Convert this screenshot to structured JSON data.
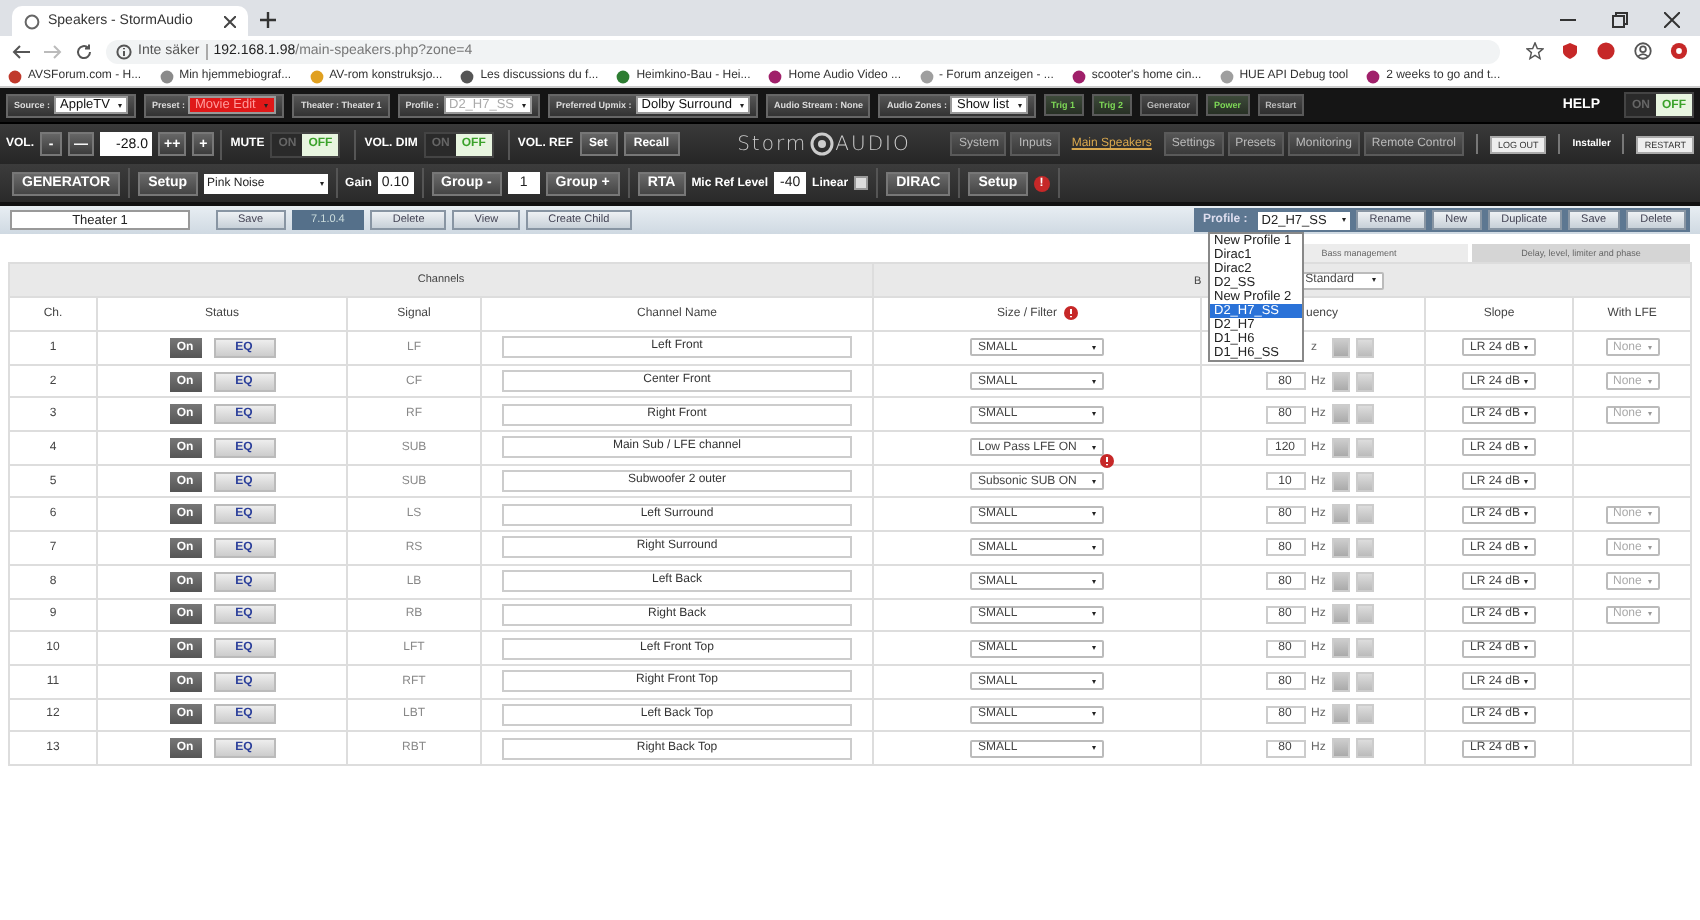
{
  "browser": {
    "tab_title": "Speakers - StormAudio",
    "security": "Inte säker",
    "url_host": "192.168.1.98",
    "url_path": "/main-speakers.php?zone=4",
    "bookmarks": [
      {
        "label": "AVSForum.com - H...",
        "color": "#c0392b"
      },
      {
        "label": "Min hjemmebiograf...",
        "color": "#8a8a8a"
      },
      {
        "label": "AV-rom konstruksjo...",
        "color": "#e0a020"
      },
      {
        "label": "Les discussions du f...",
        "color": "#555555"
      },
      {
        "label": "Heimkino-Bau - Hei...",
        "color": "#2e7d32"
      },
      {
        "label": "Home Audio Video ...",
        "color": "#a0206a"
      },
      {
        "label": "- Forum anzeigen - ...",
        "color": "#9e9e9e"
      },
      {
        "label": "scooter's home cin...",
        "color": "#a0206a"
      },
      {
        "label": "HUE API Debug tool",
        "color": "#9e9e9e"
      },
      {
        "label": "2 weeks to go and t...",
        "color": "#a0206a"
      }
    ]
  },
  "topbar": {
    "fields": [
      {
        "kind": "select",
        "label": "Source :",
        "value": "AppleTV"
      },
      {
        "kind": "alert",
        "label": "Preset :",
        "value": "Movie Edit"
      },
      {
        "kind": "label",
        "label": "Theater : Theater 1"
      },
      {
        "kind": "disabled",
        "label": "Profile :",
        "value": "D2_H7_SS"
      },
      {
        "kind": "select",
        "label": "Preferred Upmix :",
        "value": "Dolby Surround"
      },
      {
        "kind": "label",
        "label": "Audio Stream : None"
      },
      {
        "kind": "select",
        "label": "Audio Zones :",
        "value": "Show list"
      }
    ],
    "buttons": [
      {
        "label": "Trig 1",
        "active": true
      },
      {
        "label": "Trig 2",
        "active": true
      },
      {
        "label": "Generator",
        "active": false
      },
      {
        "label": "Power",
        "active": true
      },
      {
        "label": "Restart",
        "active": false
      }
    ],
    "help": {
      "label": "HELP",
      "on_label": "ON",
      "off_label": "OFF",
      "on": false
    }
  },
  "volume": {
    "label": "VOL.",
    "down_buttons": [
      "-",
      "—"
    ],
    "value": "-28.0",
    "up_buttons": [
      "++",
      "+"
    ],
    "toggles": [
      {
        "label": "MUTE",
        "on_label": "ON",
        "off_label": "OFF",
        "on": false
      },
      {
        "label": "VOL. DIM",
        "on_label": "ON",
        "off_label": "OFF",
        "on": false
      }
    ],
    "ref_label": "VOL. REF",
    "ref_buttons": [
      "Set",
      "Recall"
    ]
  },
  "logo": {
    "left": "Storm",
    "right": "AUDIO"
  },
  "nav": [
    {
      "label": "System",
      "selected": false
    },
    {
      "label": "Inputs",
      "selected": false
    },
    {
      "label": "Main Speakers",
      "selected": true
    },
    {
      "label": "Settings",
      "selected": false
    },
    {
      "label": "Presets",
      "selected": false
    },
    {
      "label": "Monitoring",
      "selected": false
    },
    {
      "label": "Remote Control",
      "selected": false
    }
  ],
  "session": {
    "logout": "LOG OUT",
    "user": "Installer",
    "restart": "RESTART"
  },
  "generator": [
    [
      {
        "kind": "button",
        "label": "GENERATOR"
      }
    ],
    [
      {
        "kind": "button",
        "label": "Setup"
      },
      {
        "kind": "select",
        "label": "Pink Noise"
      }
    ],
    [
      {
        "kind": "label",
        "label": "Gain"
      },
      {
        "kind": "input",
        "label": "0.10"
      }
    ],
    [
      {
        "kind": "button",
        "label": "Group -"
      },
      {
        "kind": "input",
        "label": "1"
      },
      {
        "kind": "button",
        "label": "Group +"
      }
    ],
    [
      {
        "kind": "button",
        "label": "RTA"
      },
      {
        "kind": "label",
        "label": "Mic Ref Level"
      },
      {
        "kind": "input",
        "label": "-40"
      },
      {
        "kind": "label",
        "label": "Linear"
      },
      {
        "kind": "checkbox",
        "checked": false
      }
    ],
    [
      {
        "kind": "button",
        "label": "DIRAC"
      }
    ],
    [
      {
        "kind": "button",
        "label": "Setup"
      },
      {
        "kind": "alert",
        "label": "!"
      }
    ]
  ],
  "theater": {
    "name": "Theater 1",
    "items": [
      {
        "kind": "button",
        "label": "Save"
      },
      {
        "kind": "label",
        "label": "7.1.0.4"
      },
      {
        "kind": "button",
        "label": "Delete"
      },
      {
        "kind": "button",
        "label": "View"
      },
      {
        "kind": "button",
        "label": "Create Child"
      }
    ],
    "profile_label": "Profile :",
    "profile": "D2_H7_SS",
    "profile_buttons": [
      "Rename",
      "New",
      "Duplicate",
      "Save",
      "Delete"
    ],
    "profile_options": [
      {
        "label": "New Profile 1",
        "selected": false
      },
      {
        "label": "Dirac1",
        "selected": false
      },
      {
        "label": "Dirac2",
        "selected": false
      },
      {
        "label": "D2_SS",
        "selected": false
      },
      {
        "label": "New Profile 2",
        "selected": false
      },
      {
        "label": "D2_H7_SS",
        "selected": true
      },
      {
        "label": "D2_H7",
        "selected": false
      },
      {
        "label": "D1_H6",
        "selected": false
      },
      {
        "label": "D1_H6_SS",
        "selected": false
      }
    ]
  },
  "subtabs": [
    {
      "label": "Bass management",
      "selected": true
    },
    {
      "label": "Delay, level, limiter and phase",
      "selected": false
    }
  ],
  "table": {
    "title": "Channels",
    "bass_label": "B",
    "bass_mode": "Standard",
    "columns": [
      {
        "label": "Ch.",
        "alert": false
      },
      {
        "label": "Status",
        "alert": false
      },
      {
        "label": "Signal",
        "alert": false
      },
      {
        "label": "Channel Name",
        "alert": false
      },
      {
        "label": "Size / Filter",
        "alert": true
      },
      {
        "label": "uency",
        "alert": false
      },
      {
        "label": "Slope",
        "alert": false
      },
      {
        "label": "With LFE",
        "alert": false
      }
    ],
    "rows": [
      {
        "ch": "1",
        "on": "On",
        "eq": "EQ",
        "signal": "LF",
        "name": "Left Front",
        "filter": "SMALL",
        "unit": "z",
        "slope": "LR 24 dB",
        "lfe": "None",
        "warning": false
      },
      {
        "ch": "2",
        "on": "On",
        "eq": "EQ",
        "signal": "CF",
        "name": "Center Front",
        "filter": "SMALL",
        "freq": "80",
        "unit": "Hz",
        "slope": "LR 24 dB",
        "lfe": "None",
        "warning": false
      },
      {
        "ch": "3",
        "on": "On",
        "eq": "EQ",
        "signal": "RF",
        "name": "Right Front",
        "filter": "SMALL",
        "freq": "80",
        "unit": "Hz",
        "slope": "LR 24 dB",
        "lfe": "None",
        "warning": false
      },
      {
        "ch": "4",
        "on": "On",
        "eq": "EQ",
        "signal": "SUB",
        "name": "Main Sub / LFE channel",
        "filter": "Low Pass LFE ON",
        "freq": "120",
        "unit": "Hz",
        "slope": "LR 24 dB",
        "warning": true
      },
      {
        "ch": "5",
        "on": "On",
        "eq": "EQ",
        "signal": "SUB",
        "name": "Subwoofer 2 outer",
        "filter": "Subsonic SUB ON",
        "freq": "10",
        "unit": "Hz",
        "slope": "LR 24 dB",
        "warning": false
      },
      {
        "ch": "6",
        "on": "On",
        "eq": "EQ",
        "signal": "LS",
        "name": "Left Surround",
        "filter": "SMALL",
        "freq": "80",
        "unit": "Hz",
        "slope": "LR 24 dB",
        "lfe": "None",
        "warning": false
      },
      {
        "ch": "7",
        "on": "On",
        "eq": "EQ",
        "signal": "RS",
        "name": "Right Surround",
        "filter": "SMALL",
        "freq": "80",
        "unit": "Hz",
        "slope": "LR 24 dB",
        "lfe": "None",
        "warning": false
      },
      {
        "ch": "8",
        "on": "On",
        "eq": "EQ",
        "signal": "LB",
        "name": "Left Back",
        "filter": "SMALL",
        "freq": "80",
        "unit": "Hz",
        "slope": "LR 24 dB",
        "lfe": "None",
        "warning": false
      },
      {
        "ch": "9",
        "on": "On",
        "eq": "EQ",
        "signal": "RB",
        "name": "Right Back",
        "filter": "SMALL",
        "freq": "80",
        "unit": "Hz",
        "slope": "LR 24 dB",
        "lfe": "None",
        "warning": false
      },
      {
        "ch": "10",
        "on": "On",
        "eq": "EQ",
        "signal": "LFT",
        "name": "Left Front Top",
        "filter": "SMALL",
        "freq": "80",
        "unit": "Hz",
        "slope": "LR 24 dB",
        "warning": false
      },
      {
        "ch": "11",
        "on": "On",
        "eq": "EQ",
        "signal": "RFT",
        "name": "Right Front Top",
        "filter": "SMALL",
        "freq": "80",
        "unit": "Hz",
        "slope": "LR 24 dB",
        "warning": false
      },
      {
        "ch": "12",
        "on": "On",
        "eq": "EQ",
        "signal": "LBT",
        "name": "Left Back Top",
        "filter": "SMALL",
        "freq": "80",
        "unit": "Hz",
        "slope": "LR 24 dB",
        "warning": false
      },
      {
        "ch": "13",
        "on": "On",
        "eq": "EQ",
        "signal": "RBT",
        "name": "Right Back Top",
        "filter": "SMALL",
        "freq": "80",
        "unit": "Hz",
        "slope": "LR 24 dB",
        "warning": false
      }
    ]
  }
}
